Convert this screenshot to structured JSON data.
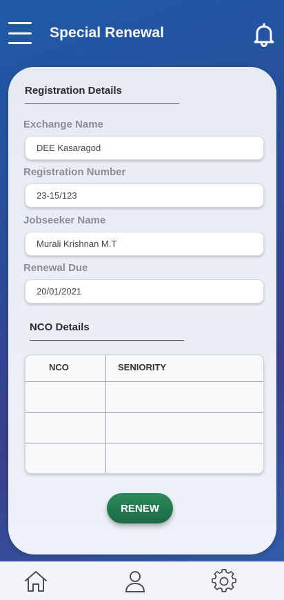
{
  "header": {
    "title": "Special Renewal",
    "menu_icon": "hamburger-menu-icon",
    "notification_icon": "bell-icon"
  },
  "registration": {
    "section_title": "Registration Details",
    "fields": [
      {
        "label": "Exchange Name",
        "value": "DEE Kasaragod"
      },
      {
        "label": "Registration Number",
        "value": "23-15/123"
      },
      {
        "label": "Jobseeker Name",
        "value": "Murali Krishnan M.T"
      },
      {
        "label": "Renewal Due",
        "value": "20/01/2021"
      }
    ]
  },
  "nco": {
    "section_title": "NCO Details",
    "columns": [
      "NCO",
      "SENIORITY"
    ],
    "rows": [
      [
        "",
        ""
      ],
      [
        "",
        ""
      ],
      [
        "",
        ""
      ]
    ]
  },
  "actions": {
    "renew_label": "RENEW",
    "renew_color": "#1f7a4d"
  },
  "bottom_nav": {
    "items": [
      {
        "icon": "home-icon"
      },
      {
        "icon": "user-icon"
      },
      {
        "icon": "settings-gear-icon"
      }
    ]
  },
  "colors": {
    "background_top": "#1f5aa6",
    "background_mid": "#3a3f8c",
    "card": "#e9edf4",
    "label_gray": "#8a8d93"
  }
}
